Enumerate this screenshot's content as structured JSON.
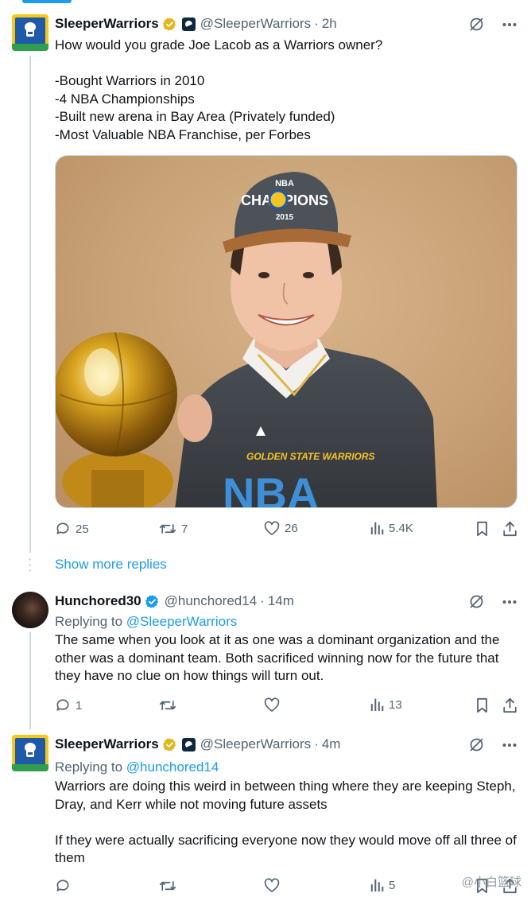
{
  "accent_color": "#1d9bf0",
  "tweets": [
    {
      "name": "SleeperWarriors",
      "handle": "@SleeperWarriors",
      "separator": "·",
      "time": "2h",
      "verified": "gold",
      "text": "How would you grade Joe Lacob as a Warriors owner?\n\n-Bought Warriors in 2010\n-4 NBA Championships\n-Built new arena in Bay Area (Privately funded)\n-Most Valuable NBA Franchise, per Forbes",
      "image": {
        "cap_line1": "NBA",
        "cap_line2": "CHAMPIONS",
        "cap_line3": "2015",
        "shirt_line1": "GOLDEN STATE WARRIORS",
        "shirt_line2": "NBA"
      },
      "replies": "25",
      "reposts": "7",
      "likes": "26",
      "views": "5.4K"
    },
    {
      "name": "Hunchored30",
      "handle": "@hunchored14",
      "separator": "·",
      "time": "14m",
      "verified": "blue",
      "replying_label": "Replying to",
      "replying_to": "@SleeperWarriors",
      "text": "The same when you look at it as one was a dominant organization and the other was a dominant team. Both sacrificed winning now for the future that they have no clue on how things will turn out.",
      "replies": "1",
      "reposts": "",
      "likes": "",
      "views": "13"
    },
    {
      "name": "SleeperWarriors",
      "handle": "@SleeperWarriors",
      "separator": "·",
      "time": "4m",
      "verified": "gold",
      "replying_label": "Replying to",
      "replying_to": "@hunchored14",
      "text": "Warriors are doing this weird in between thing where they are keeping Steph, Dray, and Kerr while not moving future assets\n\nIf they were actually sacrificing everyone now they would move off all three of them",
      "replies": "",
      "reposts": "",
      "likes": "",
      "views": "5"
    }
  ],
  "show_more_replies": "Show more replies",
  "watermark": "@小白篮球"
}
